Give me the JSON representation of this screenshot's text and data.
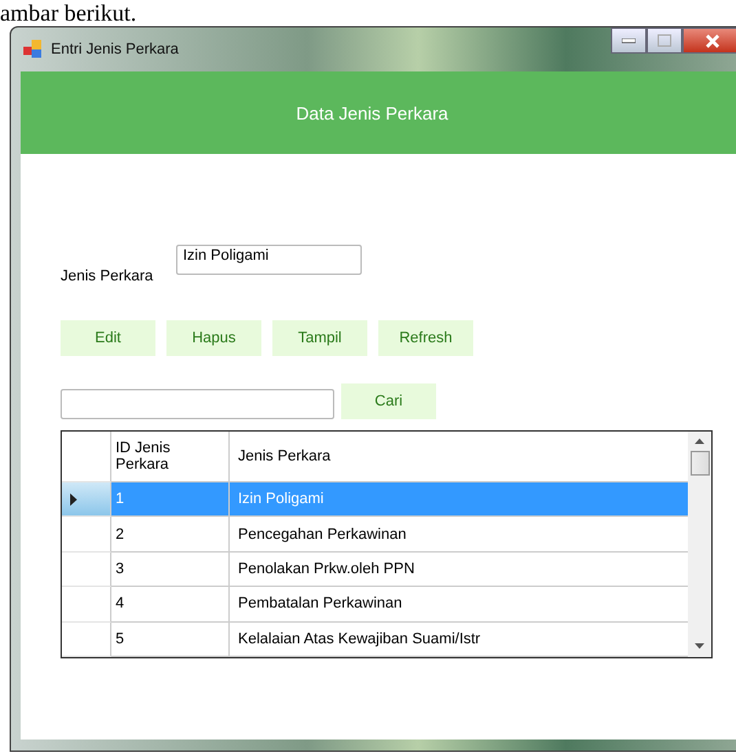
{
  "page_caption": "ambar berikut.",
  "window": {
    "title": "Entri Jenis Perkara"
  },
  "header": {
    "title": "Data Jenis Perkara"
  },
  "form": {
    "label": "Jenis Perkara",
    "value": "Izin Poligami"
  },
  "buttons": [
    "Edit",
    "Hapus",
    "Tampil",
    "Refresh"
  ],
  "search": {
    "button": "Cari"
  },
  "table": {
    "columns": [
      "ID Jenis Perkara",
      "Jenis Perkara"
    ],
    "rows": [
      {
        "cells": [
          "1",
          "Izin Poligami"
        ],
        "selected": true
      },
      {
        "cells": [
          "2",
          "Pencegahan Perkawinan"
        ],
        "selected": false
      },
      {
        "cells": [
          "3",
          "Penolakan Prkw.oleh PPN"
        ],
        "selected": false
      },
      {
        "cells": [
          "4",
          "Pembatalan Perkawinan"
        ],
        "selected": false
      },
      {
        "cells": [
          "5",
          "Kelalaian Atas Kewajiban Suami/Istr"
        ],
        "selected": false
      }
    ]
  }
}
